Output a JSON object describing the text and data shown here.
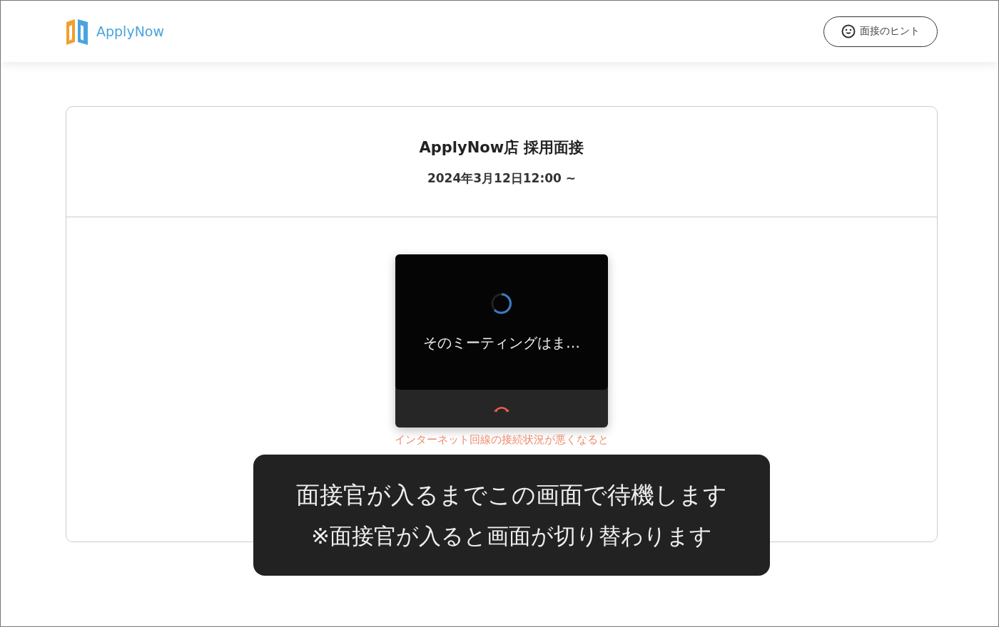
{
  "header": {
    "brand": "ApplyNow",
    "hint_button": "面接のヒント"
  },
  "interview": {
    "title": "ApplyNow店 採用面接",
    "datetime": "2024年3月12日12:00 ~"
  },
  "video": {
    "status": "そのミーティングはま…",
    "warning": "インターネット回線の接続状況が悪くなると"
  },
  "toast": {
    "message": "面接官が入るまでこの画面で待機します",
    "note": "※面接官が入ると画面が切り替わります"
  }
}
